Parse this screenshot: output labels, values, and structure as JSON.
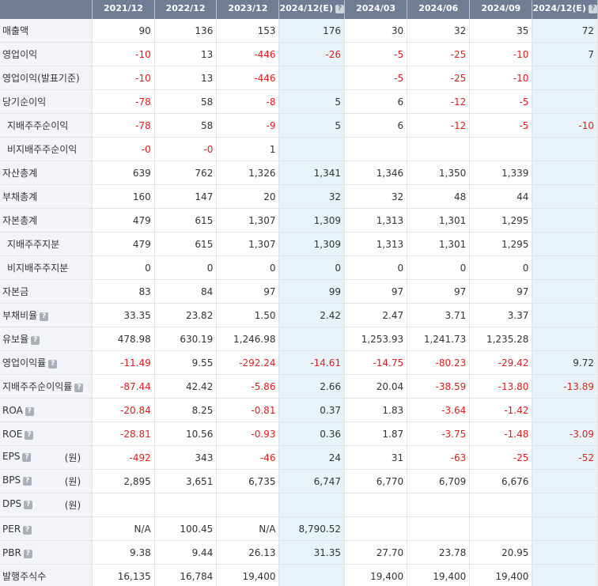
{
  "header": {
    "corner": "",
    "periods": [
      "2021/12",
      "2022/12",
      "2023/12",
      "2024/12(E)",
      "2024/03",
      "2024/06",
      "2024/09",
      "2024/12(E)"
    ],
    "help_flags": [
      false,
      false,
      false,
      true,
      false,
      false,
      false,
      true
    ],
    "estimate_cols": [
      3,
      7
    ]
  },
  "rows": [
    {
      "label": "매출액",
      "indent": false,
      "help": false,
      "unit": "",
      "values": [
        "90",
        "136",
        "153",
        "176",
        "30",
        "32",
        "35",
        "72"
      ]
    },
    {
      "label": "영업이익",
      "indent": false,
      "help": false,
      "unit": "",
      "values": [
        "-10",
        "13",
        "-446",
        "-26",
        "-5",
        "-25",
        "-10",
        "7"
      ]
    },
    {
      "label": "영업이익(발표기준)",
      "indent": false,
      "help": false,
      "unit": "",
      "values": [
        "-10",
        "13",
        "-446",
        "",
        "-5",
        "-25",
        "-10",
        ""
      ]
    },
    {
      "label": "당기순이익",
      "indent": false,
      "help": false,
      "unit": "",
      "values": [
        "-78",
        "58",
        "-8",
        "5",
        "6",
        "-12",
        "-5",
        ""
      ]
    },
    {
      "label": "지배주주순이익",
      "indent": true,
      "help": false,
      "unit": "",
      "values": [
        "-78",
        "58",
        "-9",
        "5",
        "6",
        "-12",
        "-5",
        "-10"
      ]
    },
    {
      "label": "비지배주주순이익",
      "indent": true,
      "help": false,
      "unit": "",
      "values": [
        "-0",
        "-0",
        "1",
        "",
        "",
        "",
        "",
        ""
      ]
    },
    {
      "label": "자산총계",
      "indent": false,
      "help": false,
      "unit": "",
      "values": [
        "639",
        "762",
        "1,326",
        "1,341",
        "1,346",
        "1,350",
        "1,339",
        ""
      ]
    },
    {
      "label": "부채총계",
      "indent": false,
      "help": false,
      "unit": "",
      "values": [
        "160",
        "147",
        "20",
        "32",
        "32",
        "48",
        "44",
        ""
      ]
    },
    {
      "label": "자본총계",
      "indent": false,
      "help": false,
      "unit": "",
      "values": [
        "479",
        "615",
        "1,307",
        "1,309",
        "1,313",
        "1,301",
        "1,295",
        ""
      ]
    },
    {
      "label": "지배주주지분",
      "indent": true,
      "help": false,
      "unit": "",
      "values": [
        "479",
        "615",
        "1,307",
        "1,309",
        "1,313",
        "1,301",
        "1,295",
        ""
      ]
    },
    {
      "label": "비지배주주지분",
      "indent": true,
      "help": false,
      "unit": "",
      "values": [
        "0",
        "0",
        "0",
        "0",
        "0",
        "0",
        "0",
        ""
      ]
    },
    {
      "label": "자본금",
      "indent": false,
      "help": false,
      "unit": "",
      "values": [
        "83",
        "84",
        "97",
        "99",
        "97",
        "97",
        "97",
        ""
      ]
    },
    {
      "label": "부채비율",
      "indent": false,
      "help": true,
      "unit": "",
      "values": [
        "33.35",
        "23.82",
        "1.50",
        "2.42",
        "2.47",
        "3.71",
        "3.37",
        ""
      ]
    },
    {
      "label": "유보율",
      "indent": false,
      "help": true,
      "unit": "",
      "values": [
        "478.98",
        "630.19",
        "1,246.98",
        "",
        "1,253.93",
        "1,241.73",
        "1,235.28",
        ""
      ]
    },
    {
      "label": "영업이익률",
      "indent": false,
      "help": true,
      "unit": "",
      "values": [
        "-11.49",
        "9.55",
        "-292.24",
        "-14.61",
        "-14.75",
        "-80.23",
        "-29.42",
        "9.72"
      ]
    },
    {
      "label": "지배주주순이익률",
      "indent": false,
      "help": true,
      "unit": "",
      "values": [
        "-87.44",
        "42.42",
        "-5.86",
        "2.66",
        "20.04",
        "-38.59",
        "-13.80",
        "-13.89"
      ]
    },
    {
      "label": "ROA",
      "indent": false,
      "help": true,
      "unit": "",
      "values": [
        "-20.84",
        "8.25",
        "-0.81",
        "0.37",
        "1.83",
        "-3.64",
        "-1.42",
        ""
      ]
    },
    {
      "label": "ROE",
      "indent": false,
      "help": true,
      "unit": "",
      "values": [
        "-28.81",
        "10.56",
        "-0.93",
        "0.36",
        "1.87",
        "-3.75",
        "-1.48",
        "-3.09"
      ]
    },
    {
      "label": "EPS",
      "indent": false,
      "help": true,
      "unit": "(원)",
      "values": [
        "-492",
        "343",
        "-46",
        "24",
        "31",
        "-63",
        "-25",
        "-52"
      ]
    },
    {
      "label": "BPS",
      "indent": false,
      "help": true,
      "unit": "(원)",
      "values": [
        "2,895",
        "3,651",
        "6,735",
        "6,747",
        "6,770",
        "6,709",
        "6,676",
        ""
      ]
    },
    {
      "label": "DPS",
      "indent": false,
      "help": true,
      "unit": "(원)",
      "values": [
        "",
        "",
        "",
        "",
        "",
        "",
        "",
        ""
      ]
    },
    {
      "label": "PER",
      "indent": false,
      "help": true,
      "unit": "",
      "values": [
        "N/A",
        "100.45",
        "N/A",
        "8,790.52",
        "",
        "",
        "",
        ""
      ]
    },
    {
      "label": "PBR",
      "indent": false,
      "help": true,
      "unit": "",
      "values": [
        "9.38",
        "9.44",
        "26.13",
        "31.35",
        "27.70",
        "23.78",
        "20.95",
        ""
      ]
    },
    {
      "label": "발행주식수",
      "indent": false,
      "help": false,
      "unit": "",
      "values": [
        "16,135",
        "16,784",
        "19,400",
        "",
        "19,400",
        "19,400",
        "19,400",
        ""
      ]
    }
  ]
}
